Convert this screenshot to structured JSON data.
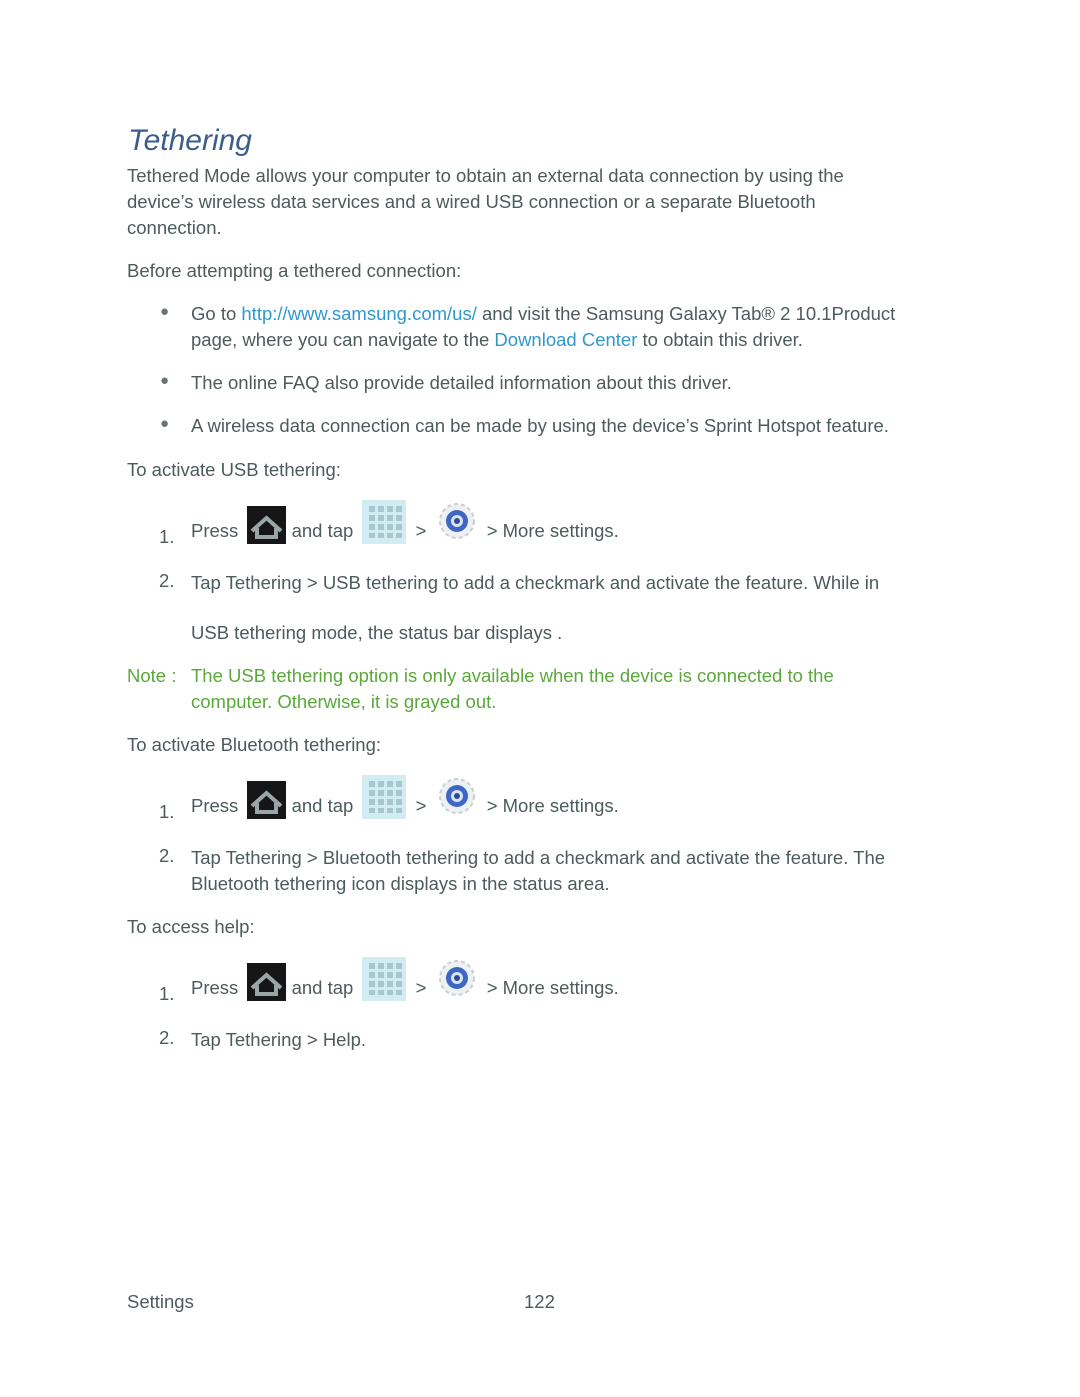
{
  "title": "Tethering",
  "intro": {
    "lines": [
      "Tethered Mode allows your computer to obtain an external data connection by using the",
      "device’s wireless data services and a wired USB connection or a separate Bluetooth",
      "connection."
    ]
  },
  "before_label": "Before attempting a tethered connection:",
  "bullets": [
    {
      "line1_pre": "Go to ",
      "line1_link": "http://www.samsung.com/us/",
      "line1_post": " and visit the Samsung Galaxy Tab®  2 10.1Product",
      "line2_pre": "page, where you can navigate to the ",
      "line2_link": "Download Center",
      "line2_post": " to obtain this driver."
    },
    {
      "text": "The online FAQ also provide detailed information about this driver."
    },
    {
      "text": "A wireless data connection can be made by using the device’s Sprint Hotspot feature."
    }
  ],
  "usb": {
    "heading": "To activate USB tethering:",
    "step1": {
      "num": "1.",
      "press": "Press",
      "and_tap": "and tap",
      "sep": ">",
      "tail": "> More settings."
    },
    "step2": {
      "num": "2.",
      "line1": "Tap Tethering  > USB tethering to add a checkmark and activate the feature. While in",
      "line2": "USB tethering mode, the status bar displays       ."
    },
    "note": {
      "label": "Note :",
      "line1": "The USB tethering option is only available when the device   is connected to the",
      "line2": "computer. Otherwise, it is grayed out."
    }
  },
  "bluetooth": {
    "heading": "To activate Bluetooth tethering:",
    "step1": {
      "num": "1.",
      "press": "Press",
      "and_tap": "and tap",
      "sep": ">",
      "tail": "> More settings."
    },
    "step2": {
      "num": "2.",
      "line1": "Tap Tethering  > Bluetooth   tethering   to add a checkmark and activate the feature. The",
      "line2": "Bluetooth tethering icon displays in the status area."
    }
  },
  "help": {
    "heading": "To access help:",
    "step1": {
      "num": "1.",
      "press": "Press",
      "and_tap": "and tap",
      "sep": ">",
      "tail": "> More settings."
    },
    "step2": {
      "num": "2.",
      "line1": "Tap Tethering  > Help."
    }
  },
  "footer": {
    "section": "Settings",
    "page": "122"
  },
  "icons": {
    "home": "home-key-icon",
    "apps": "applications-icon",
    "settings": "settings-gear-icon"
  }
}
